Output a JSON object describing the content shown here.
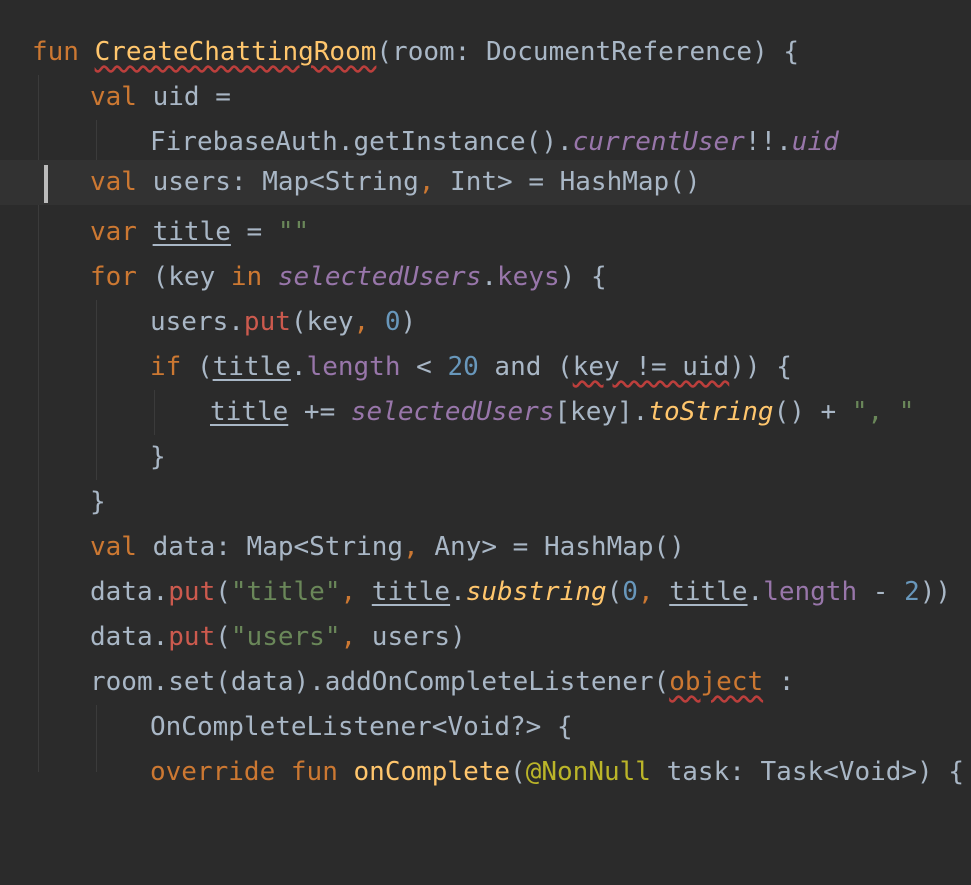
{
  "editor": {
    "theme": "darcula",
    "colors": {
      "background": "#2b2b2b",
      "current_line": "#323232",
      "keyword": "#cc7832",
      "function": "#ffc66d",
      "property": "#9876aa",
      "string": "#6a8759",
      "number": "#6897bb",
      "text": "#a9b7c6"
    },
    "lines": {
      "l1": {
        "t1": "fun ",
        "t2": "CreateChattingRoom",
        "t3": "(room: DocumentReference) {"
      },
      "l2": {
        "t1": "val ",
        "t2": "uid ="
      },
      "l3": {
        "t1": "FirebaseAuth.getInstance().",
        "t2": "currentUser",
        "t3": "!!.",
        "t4": "uid"
      },
      "l4": {
        "t1": "val ",
        "t2": "users: Map<String",
        "t3": ", ",
        "t4": "Int> = HashMap()"
      },
      "l5": {
        "t1": "var ",
        "t2": "title",
        "t3": " = ",
        "t4": "\"\""
      },
      "l6": {
        "t1": "for ",
        "t2": "(key ",
        "t3": "in ",
        "t4": "selectedUsers",
        "t5": ".",
        "t6": "keys",
        "t7": ") {"
      },
      "l7": {
        "t1": "users.",
        "t2": "put",
        "t3": "(key",
        "t4": ", ",
        "t5": "0",
        "t6": ")"
      },
      "l8": {
        "t1": "if ",
        "t2": "(",
        "t3": "title",
        "t4": ".",
        "t5": "length",
        "t6": " < ",
        "t7": "20",
        "t8": " and (",
        "t9": "key != uid",
        "t10": ")) {"
      },
      "l9": {
        "t1": "title",
        "t2": " += ",
        "t3": "selectedUsers",
        "t4": "[key].",
        "t5": "toString",
        "t6": "() + ",
        "t7": "\", \""
      },
      "l10": {
        "t1": "}"
      },
      "l11": {
        "t1": "}"
      },
      "l12": {
        "t1": "val ",
        "t2": "data: Map<String",
        "t3": ", ",
        "t4": "Any> = HashMap()"
      },
      "l13": {
        "t1": "data.",
        "t2": "put",
        "t3": "(",
        "t4": "\"title\"",
        "t5": ", ",
        "t6": "title",
        "t7": ".",
        "t8": "substring",
        "t9": "(",
        "t10": "0",
        "t11": ", ",
        "t12": "title",
        "t13": ".",
        "t14": "length",
        "t15": " - ",
        "t16": "2",
        "t17": "))"
      },
      "l14": {
        "t1": "data.",
        "t2": "put",
        "t3": "(",
        "t4": "\"users\"",
        "t5": ", ",
        "t6": "users)"
      },
      "l15": {
        "t1": "room.set(data).addOnCompleteListener(",
        "t2": "object",
        "t3": " :"
      },
      "l16": {
        "t1": "OnCompleteListener<Void?> {"
      },
      "l17": {
        "t1": "override ",
        "t2": "fun ",
        "t3": "onComplete",
        "t4": "(",
        "t5": "@NonNull",
        "t6": " task: Task<Void>) {"
      }
    }
  }
}
